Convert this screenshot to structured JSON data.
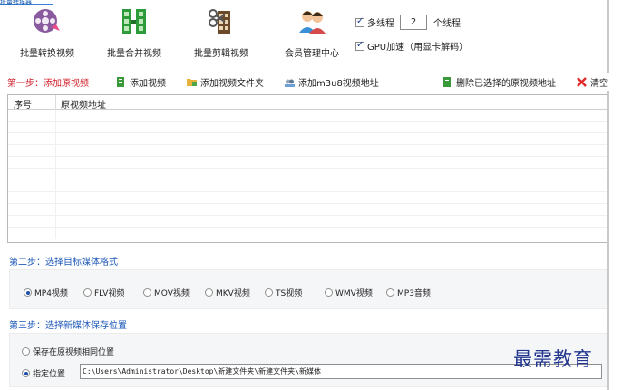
{
  "window": {
    "top_tab": "批量转换器"
  },
  "toolbar": {
    "items": [
      {
        "label": "批量转换视频",
        "icon": "film-reel-icon"
      },
      {
        "label": "批量合并视频",
        "icon": "film-strip-icon"
      },
      {
        "label": "批量剪辑视频",
        "icon": "scissors-film-icon"
      },
      {
        "label": "会员管理中心",
        "icon": "users-icon"
      }
    ],
    "multithread": {
      "label": "多线程",
      "checked": true,
      "value": "2",
      "suffix": "个线程"
    },
    "gpu": {
      "label": "GPU加速（用显卡解码）",
      "checked": true
    }
  },
  "step1": {
    "title": "第一步：添加原视频",
    "buttons": [
      {
        "label": "添加视频",
        "icon": "add-file-icon"
      },
      {
        "label": "添加视频文件夹",
        "icon": "folder-icon"
      },
      {
        "label": "添加m3u8视频地址",
        "icon": "link-icon"
      },
      {
        "label": "删除已选择的原视频地址",
        "icon": "delete-file-icon"
      },
      {
        "label": "清空",
        "icon": "close-icon"
      }
    ],
    "table": {
      "columns": [
        "序号",
        "原视频地址"
      ],
      "rows": []
    }
  },
  "step2": {
    "title": "第二步：选择目标媒体格式",
    "formats": [
      {
        "label": "MP4视频",
        "selected": true
      },
      {
        "label": "FLV视频",
        "selected": false
      },
      {
        "label": "MOV视频",
        "selected": false
      },
      {
        "label": "MKV视频",
        "selected": false
      },
      {
        "label": "TS视频",
        "selected": false
      },
      {
        "label": "WMV视频",
        "selected": false
      },
      {
        "label": "MP3音频",
        "selected": false
      }
    ]
  },
  "step3": {
    "title": "第三步：选择新媒体保存位置",
    "options": [
      {
        "label": "保存在原视频相同位置",
        "selected": false
      },
      {
        "label": "指定位置",
        "selected": true
      }
    ],
    "path": "C:\\Users\\Administrator\\Desktop\\新建文件夹\\新建文件夹\\新媒体"
  },
  "watermark": "最需教育",
  "colors": {
    "step1_title": "#d0202a",
    "step_title": "#1d58b8",
    "panel_bg": "#f5f6f8",
    "accent_blue": "#3a7fd5"
  }
}
